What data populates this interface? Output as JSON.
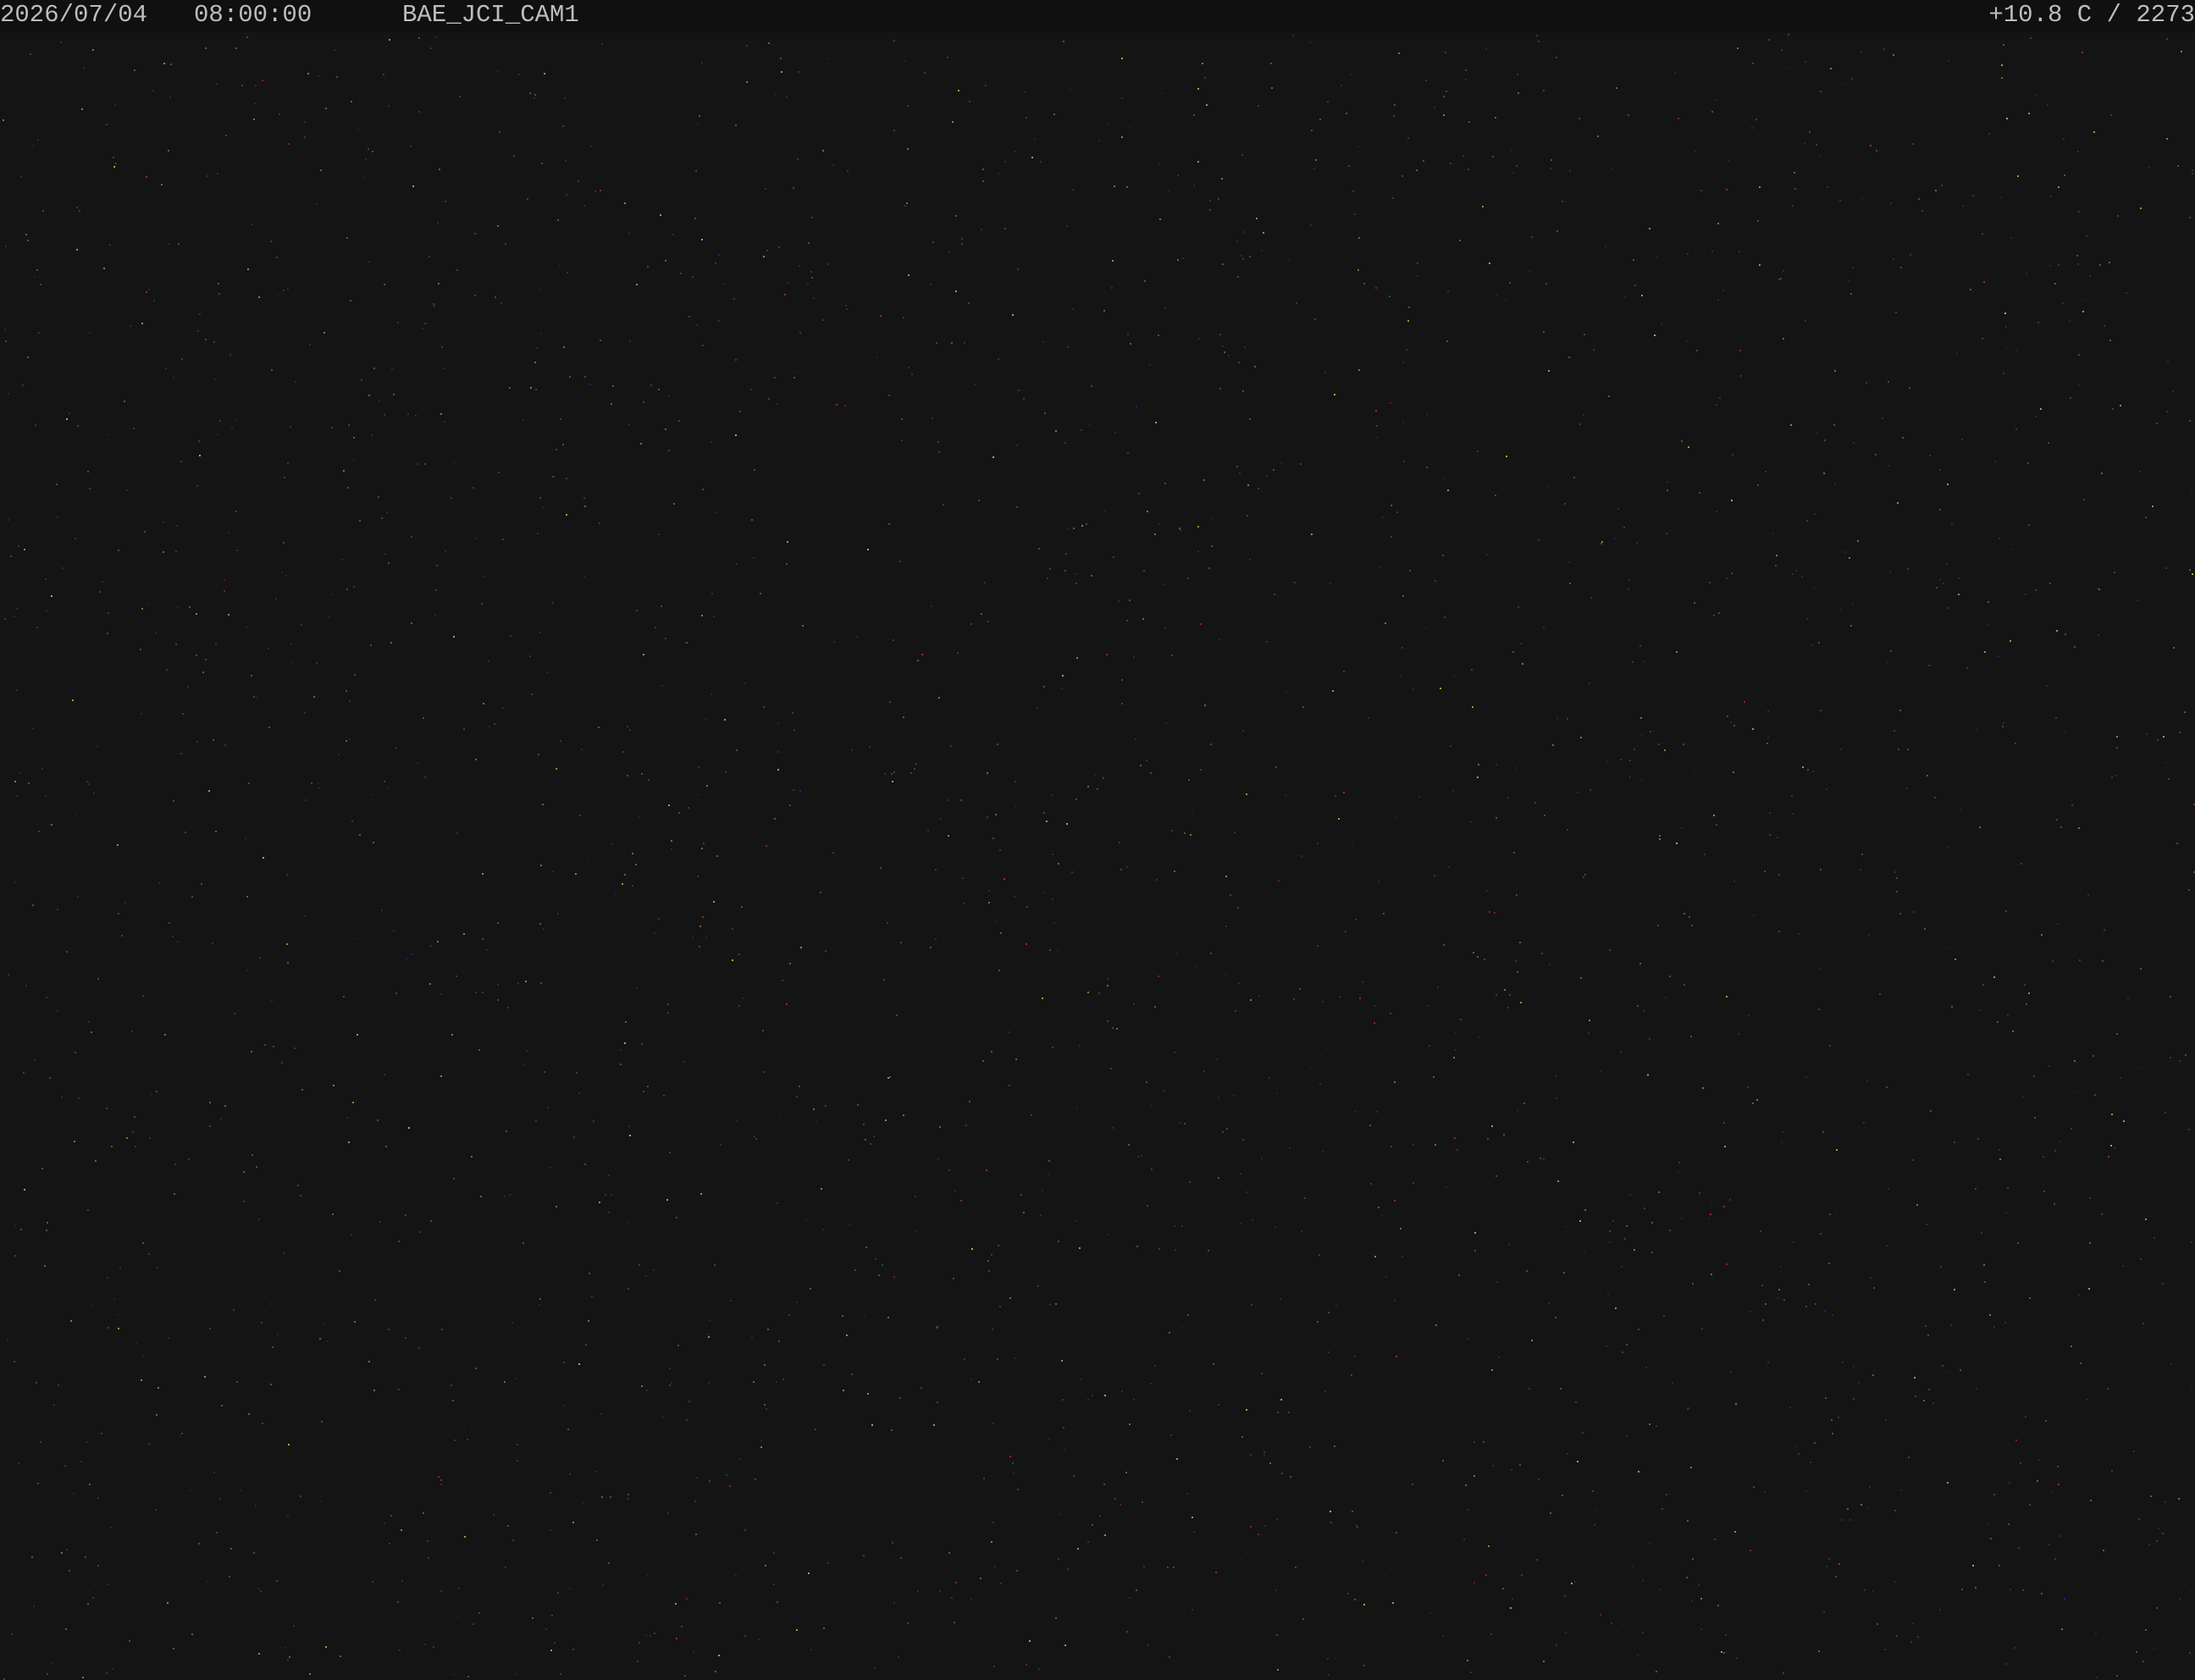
{
  "osd": {
    "date": "2026/07/04",
    "time": "08:00:00",
    "camera_name": "BAE_JCI_CAM1",
    "temperature_reading": "+10.8 C / 2273"
  },
  "colors": {
    "background": "#141414",
    "overlay_bar": "#101010",
    "osd_text": "#bdbdbd",
    "noise_palette": [
      "#8a2a2a",
      "#2a6a3a",
      "#2a2a8a",
      "#6a6a6a",
      "#b03030",
      "#c0c040"
    ]
  }
}
